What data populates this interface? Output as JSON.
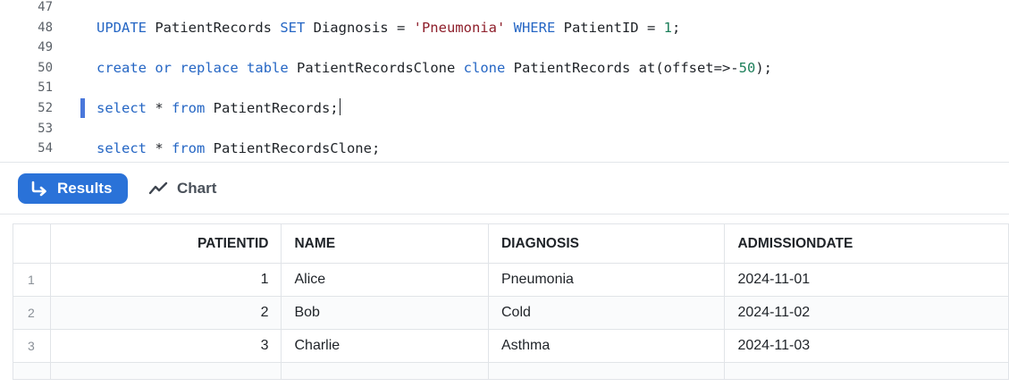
{
  "editor": {
    "lines": [
      {
        "num": "47",
        "text": ""
      },
      {
        "num": "48",
        "tokens": [
          {
            "t": "UPDATE",
            "c": "kw"
          },
          {
            "t": " PatientRecords ",
            "c": ""
          },
          {
            "t": "SET",
            "c": "kw"
          },
          {
            "t": " Diagnosis = ",
            "c": ""
          },
          {
            "t": "'Pneumonia'",
            "c": "str"
          },
          {
            "t": " ",
            "c": ""
          },
          {
            "t": "WHERE",
            "c": "kw"
          },
          {
            "t": " PatientID = ",
            "c": ""
          },
          {
            "t": "1",
            "c": "num"
          },
          {
            "t": ";",
            "c": ""
          }
        ]
      },
      {
        "num": "49",
        "text": ""
      },
      {
        "num": "50",
        "tokens": [
          {
            "t": "create",
            "c": "kw"
          },
          {
            "t": " ",
            "c": ""
          },
          {
            "t": "or",
            "c": "kw"
          },
          {
            "t": " ",
            "c": ""
          },
          {
            "t": "replace",
            "c": "kw"
          },
          {
            "t": " ",
            "c": ""
          },
          {
            "t": "table",
            "c": "kw"
          },
          {
            "t": " PatientRecordsClone ",
            "c": ""
          },
          {
            "t": "clone",
            "c": "kw"
          },
          {
            "t": " PatientRecords ",
            "c": ""
          },
          {
            "t": "at(offset=>-",
            "c": ""
          },
          {
            "t": "50",
            "c": "num"
          },
          {
            "t": ");",
            "c": ""
          }
        ]
      },
      {
        "num": "51",
        "text": ""
      },
      {
        "num": "52",
        "active": true,
        "tokens": [
          {
            "t": "select",
            "c": "kw"
          },
          {
            "t": " * ",
            "c": ""
          },
          {
            "t": "from",
            "c": "kw"
          },
          {
            "t": " PatientRecords;",
            "c": ""
          }
        ]
      },
      {
        "num": "53",
        "text": ""
      },
      {
        "num": "54",
        "tokens": [
          {
            "t": "select",
            "c": "kw"
          },
          {
            "t": " * ",
            "c": ""
          },
          {
            "t": "from",
            "c": "kw"
          },
          {
            "t": " PatientRecordsClone;",
            "c": ""
          }
        ]
      }
    ]
  },
  "toolbar": {
    "results_label": "Results",
    "chart_label": "Chart",
    "results_icon": "return-arrow-icon",
    "chart_icon": "line-chart-icon",
    "accent_color": "#2a72d8"
  },
  "table": {
    "columns": [
      "",
      "PATIENTID",
      "NAME",
      "DIAGNOSIS",
      "ADMISSIONDATE"
    ],
    "rows": [
      [
        "1",
        "1",
        "Alice",
        "Pneumonia",
        "2024-11-01"
      ],
      [
        "2",
        "2",
        "Bob",
        "Cold",
        "2024-11-02"
      ],
      [
        "3",
        "3",
        "Charlie",
        "Asthma",
        "2024-11-03"
      ]
    ]
  }
}
